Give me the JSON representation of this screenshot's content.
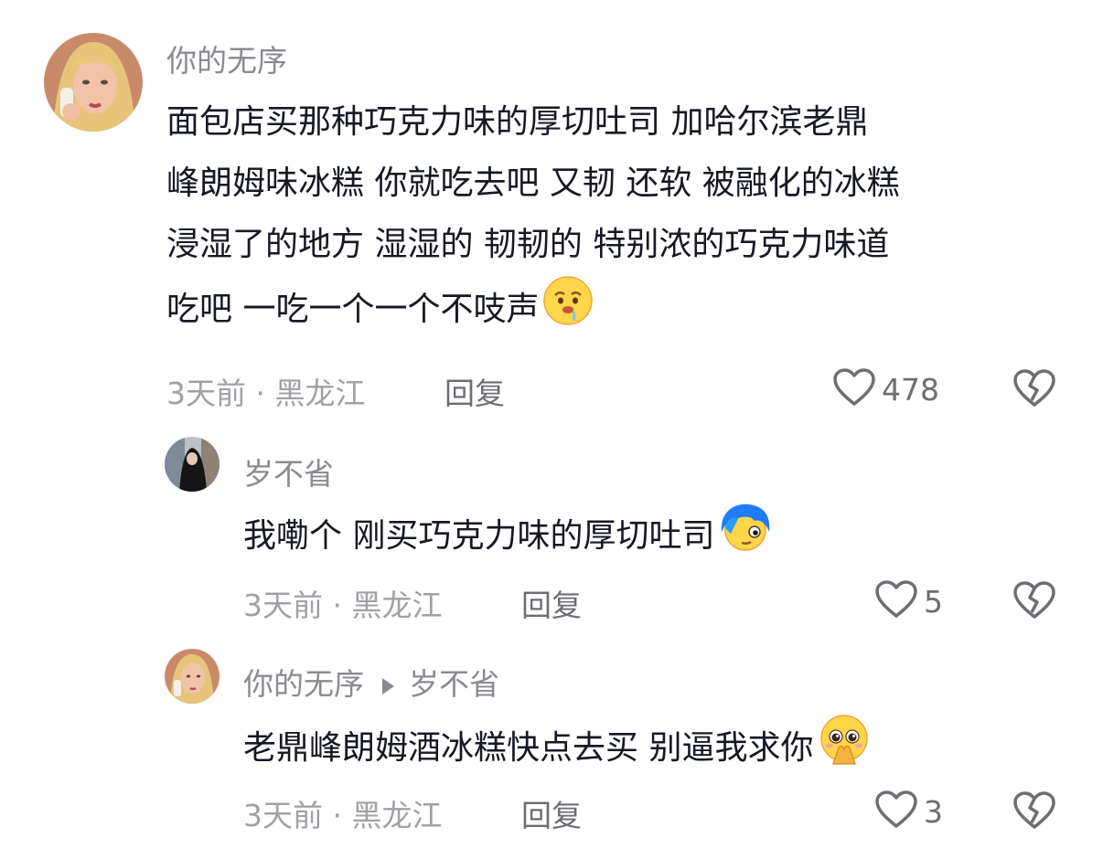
{
  "comment": {
    "username": "你的无序",
    "lines": [
      "面包店买那种巧克力味的厚切吐司 加哈尔滨老鼎",
      "峰朗姆味冰糕 你就吃去吧 又韧 还软 被融化的冰糕",
      "浸湿了的地方  湿湿的 韧韧的 特别浓的巧克力味道",
      "吃吧 一吃一个一个不吱声"
    ],
    "emoji": "drooling-face",
    "meta": "3天前 · 黑龙江",
    "reply_label": "回复",
    "likes": "478"
  },
  "replies": [
    {
      "username": "岁不省",
      "text": "我嘞个 刚买巧克力味的厚切吐司",
      "emoji": "blue-hair-face",
      "meta": "3天前 · 黑龙江",
      "reply_label": "回复",
      "likes": "5"
    },
    {
      "username": "你的无序",
      "reply_to": "岁不省",
      "text": "老鼎峰朗姆酒冰糕快点去买 别逼我求你",
      "emoji": "pleading-hands-face",
      "meta": "3天前 · 黑龙江",
      "reply_label": "回复",
      "likes": "3"
    }
  ],
  "colors": {
    "text": "#161823",
    "secondary": "#8a8b91",
    "icon": "#6d6e74"
  }
}
